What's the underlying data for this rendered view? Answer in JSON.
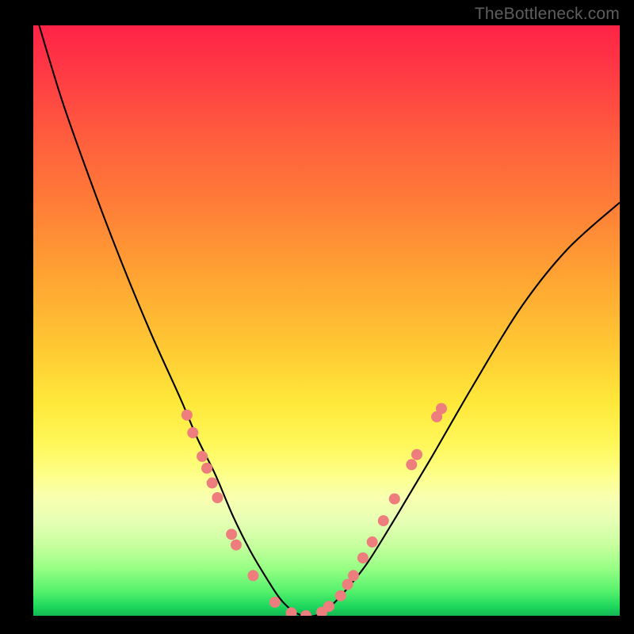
{
  "watermark": "TheBottleneck.com",
  "colors": {
    "frame": "#000000",
    "curve": "#000000",
    "dot": "#ee7d7d"
  },
  "chart_data": {
    "type": "line",
    "title": "",
    "xlabel": "",
    "ylabel": "",
    "xlim": [
      0,
      100
    ],
    "ylim": [
      0,
      100
    ],
    "note": "Bottleneck-style V-curve. x is relative component score, y is bottleneck magnitude (0 = balanced at trough). Values estimated from pixel positions; no axis labels present in source.",
    "series": [
      {
        "name": "bottleneck-curve",
        "x": [
          1,
          5,
          10,
          15,
          20,
          25,
          28,
          31,
          34,
          37,
          40,
          42,
          44,
          46,
          48,
          50,
          53,
          57,
          62,
          68,
          75,
          83,
          91,
          100
        ],
        "y": [
          100,
          87,
          73,
          60,
          48,
          37,
          30,
          24,
          17,
          11,
          6,
          3,
          1,
          0,
          0,
          1,
          4,
          9,
          17,
          27,
          39,
          52,
          62,
          70
        ]
      }
    ],
    "markers": {
      "name": "sample-points",
      "comment": "Pink dots clustered near trough on both arms",
      "points": [
        {
          "x": 26.2,
          "y": 34.0
        },
        {
          "x": 27.2,
          "y": 31.0
        },
        {
          "x": 28.8,
          "y": 27.0
        },
        {
          "x": 29.6,
          "y": 25.0
        },
        {
          "x": 30.5,
          "y": 22.5
        },
        {
          "x": 31.4,
          "y": 20.0
        },
        {
          "x": 33.8,
          "y": 13.8
        },
        {
          "x": 34.6,
          "y": 12.0
        },
        {
          "x": 37.5,
          "y": 6.8
        },
        {
          "x": 41.2,
          "y": 2.3
        },
        {
          "x": 44.0,
          "y": 0.5
        },
        {
          "x": 46.5,
          "y": 0.0
        },
        {
          "x": 49.2,
          "y": 0.6
        },
        {
          "x": 50.4,
          "y": 1.6
        },
        {
          "x": 52.4,
          "y": 3.4
        },
        {
          "x": 53.6,
          "y": 5.3
        },
        {
          "x": 54.6,
          "y": 6.8
        },
        {
          "x": 56.2,
          "y": 9.8
        },
        {
          "x": 57.8,
          "y": 12.5
        },
        {
          "x": 59.7,
          "y": 16.1
        },
        {
          "x": 61.6,
          "y": 19.8
        },
        {
          "x": 64.5,
          "y": 25.6
        },
        {
          "x": 65.4,
          "y": 27.3
        },
        {
          "x": 68.8,
          "y": 33.7
        },
        {
          "x": 69.6,
          "y": 35.1
        }
      ]
    }
  }
}
